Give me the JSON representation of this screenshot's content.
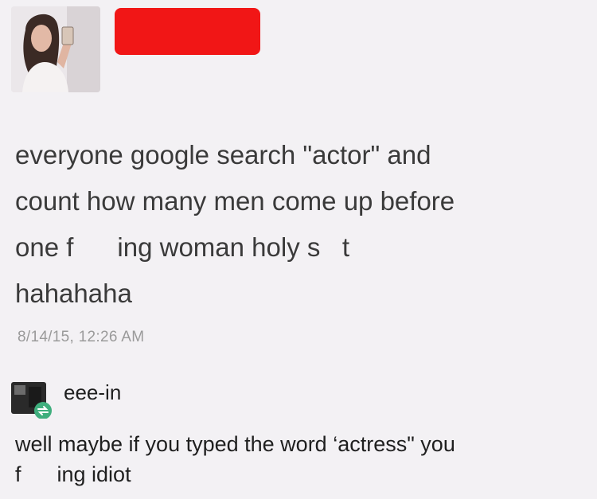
{
  "post": {
    "author_redacted": true,
    "redaction_color": "#f11616",
    "avatar": "profile-photo",
    "text_lines": [
      "everyone google search \"actor\" and",
      "count how many men come up before",
      "one f      ing woman holy s   t",
      "hahahaha"
    ],
    "timestamp": "8/14/15, 12:26 AM"
  },
  "reblog": {
    "avatar": "reblog-avatar",
    "reblog_icon": "reblog-icon",
    "username": "eee-in",
    "text_lines": [
      "well maybe if you typed the word ‘actress\" you",
      "f      ing idiot"
    ]
  }
}
